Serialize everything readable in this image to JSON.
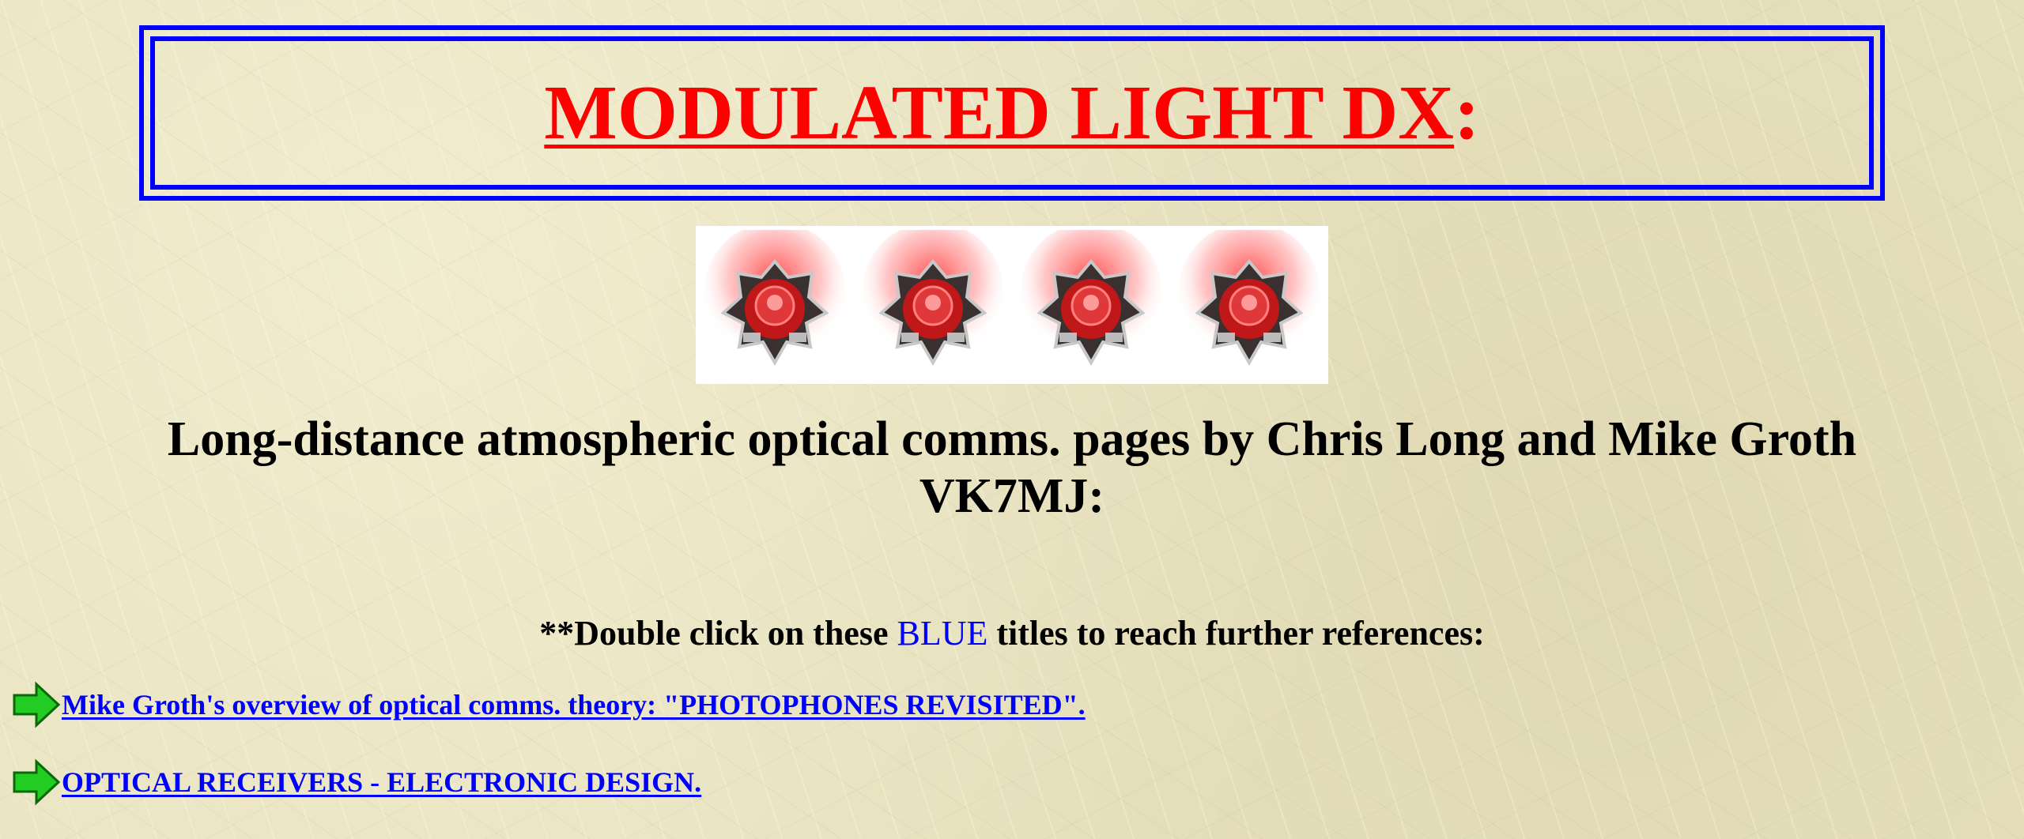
{
  "header": {
    "title": "MODULATED LIGHT DX",
    "title_suffix": ":"
  },
  "banner": {
    "image_name": "red-led-star-modules",
    "count": 4
  },
  "intro": {
    "subtitle": "Long-distance atmospheric optical comms. pages by Chris Long and Mike Groth VK7MJ:"
  },
  "instruction": {
    "prefix": "**Double click on these ",
    "highlight": "BLUE",
    "suffix": " titles to reach further references:"
  },
  "links": [
    {
      "icon": "green-arrow-icon",
      "label": "Mike Groth's overview of optical comms. theory: \"PHOTOPHONES REVISITED\"."
    },
    {
      "icon": "green-arrow-icon",
      "label": "OPTICAL RECEIVERS - ELECTRONIC DESIGN."
    }
  ],
  "colors": {
    "title": "#ff0000",
    "frame": "#0000ff",
    "link": "#0000ff",
    "arrow": "#22cc22",
    "background": "#e8e2be"
  }
}
